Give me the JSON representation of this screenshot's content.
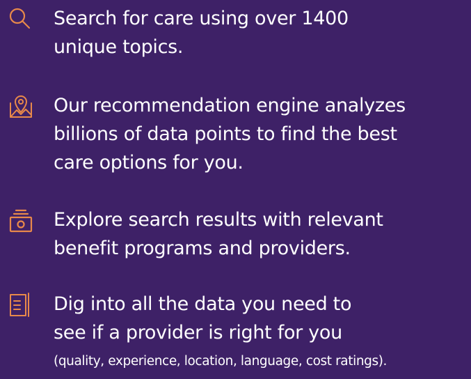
{
  "colors": {
    "background": "#3e2167",
    "icon_accent": "#e8894a",
    "text": "#ffffff"
  },
  "features": [
    {
      "icon": "search-icon",
      "lines": [
        "Search for care using over 1400",
        "unique topics."
      ]
    },
    {
      "icon": "map-location-icon",
      "lines": [
        "Our recommendation engine analyzes",
        "billions of data points to find the best",
        "care options for you."
      ]
    },
    {
      "icon": "benefits-box-icon",
      "lines": [
        "Explore search results with relevant",
        "benefit programs and providers."
      ]
    },
    {
      "icon": "document-list-icon",
      "lines": [
        "Dig into all the data you need to",
        "see if a provider is right for you"
      ],
      "note": "(quality, experience, location, language, cost ratings)."
    }
  ]
}
